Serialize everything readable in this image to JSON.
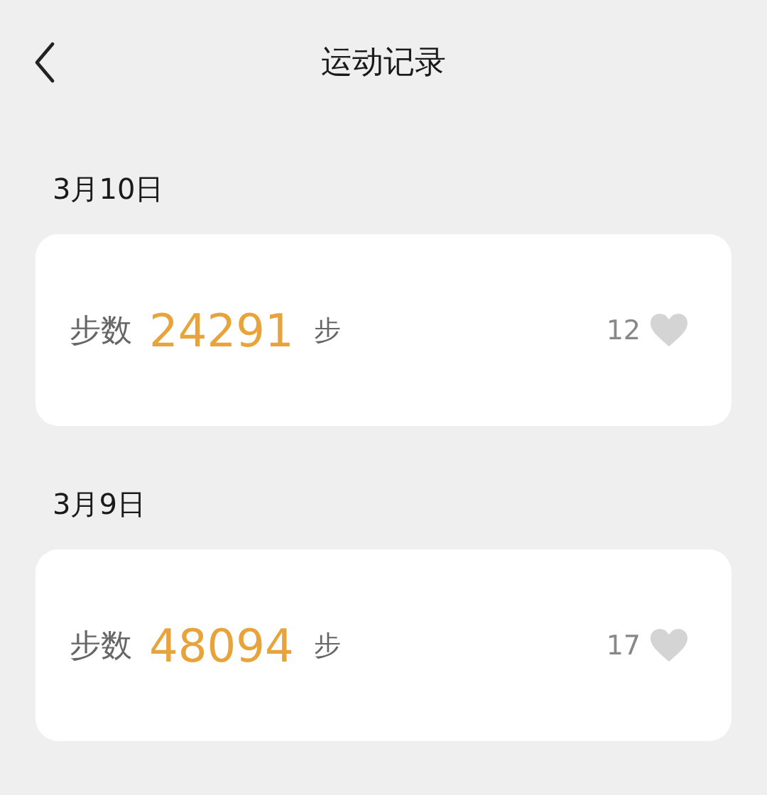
{
  "header": {
    "title": "运动记录"
  },
  "records": [
    {
      "date": "3月10日",
      "label": "步数",
      "steps": "24291",
      "unit": "步",
      "likes": "12",
      "liked": false
    },
    {
      "date": "3月9日",
      "label": "步数",
      "steps": "48094",
      "unit": "步",
      "likes": "17",
      "liked": false
    }
  ]
}
